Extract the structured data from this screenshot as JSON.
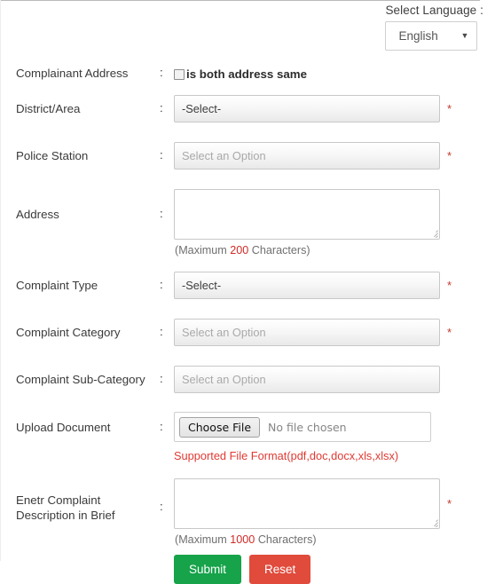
{
  "language_bar": {
    "label": "Select Language :",
    "selected": "English",
    "caret_icon": "chevron-down-icon"
  },
  "form": {
    "complainant_address": {
      "label": "Complainant Address",
      "colon": ":",
      "checkbox_text": "is both address same",
      "checked": false
    },
    "district_area": {
      "label": "District/Area",
      "colon": ":",
      "value": "-Select-",
      "required_marker": "*"
    },
    "police_station": {
      "label": "Police Station",
      "colon": ":",
      "placeholder": "Select an Option",
      "required_marker": "*"
    },
    "address": {
      "label": "Address",
      "colon": ":",
      "value": "",
      "hint_prefix": "(Maximum",
      "hint_number": "200",
      "hint_suffix": "Characters)"
    },
    "complaint_type": {
      "label": "Complaint Type",
      "colon": ":",
      "value": "-Select-",
      "required_marker": "*"
    },
    "complaint_category": {
      "label": "Complaint Category",
      "colon": ":",
      "placeholder": "Select an Option",
      "required_marker": "*"
    },
    "complaint_sub_category": {
      "label": "Complaint Sub-Category",
      "colon": ":",
      "placeholder": "Select an Option"
    },
    "upload_document": {
      "label": "Upload Document",
      "colon": ":",
      "button_label": "Choose File",
      "status": "No file chosen",
      "format_note": "Supported File Format(pdf,doc,docx,xls,xlsx)"
    },
    "complaint_description": {
      "label": "Enetr Complaint Description in Brief",
      "colon": ":",
      "value": "",
      "required_marker": "*",
      "hint_prefix": "(Maximum",
      "hint_number": "1000",
      "hint_suffix": "Characters)"
    },
    "actions": {
      "submit_label": "Submit",
      "reset_label": "Reset"
    }
  },
  "colors": {
    "submit_green": "#16a34a",
    "reset_red": "#e04b3c",
    "required_red": "#c0392b",
    "note_red": "#e03a33",
    "hint_number_red": "#d02a26"
  }
}
